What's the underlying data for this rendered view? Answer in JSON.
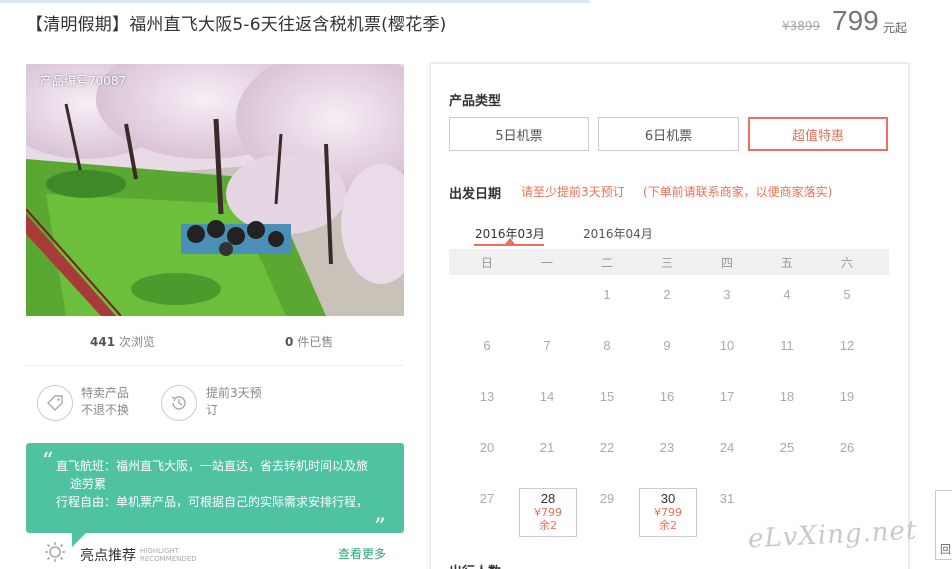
{
  "product": {
    "title": "【清明假期】福州直飞大阪5-6天往返含税机票(樱花季)",
    "original_price": "¥3899",
    "price": "799",
    "price_unit": "元起",
    "code": "产品编号70087"
  },
  "stats": {
    "views_count": "441",
    "views_label": "次浏览",
    "sold_count": "0",
    "sold_label": "件已售"
  },
  "features": [
    {
      "line1": "特卖产品",
      "line2": "不退不换",
      "icon": "tag-icon"
    },
    {
      "line1": "提前3天预",
      "line2": "订",
      "icon": "clock-icon"
    }
  ],
  "highlight": {
    "line1": "直飞航班：福州直飞大阪，一站直达，省去转机时间以及旅",
    "line2": "途劳累",
    "line3": "行程自由：单机票产品，可根据自己的实际需求安排行程，",
    "open_quote": "“",
    "close_quote": "„"
  },
  "recommend": {
    "title": "亮点推荐",
    "en_line1": "HIGHLIGHT",
    "en_line2": "RECOMMENDED",
    "more": "查看更多"
  },
  "panel": {
    "type_label": "产品类型",
    "types": [
      "5日机票",
      "6日机票",
      "超值特惠"
    ],
    "active_type": "超值特惠",
    "date_label": "出发日期",
    "notice1": "请至少提前3天预订",
    "notice2": "(下单前请联系商家，以便商家落实)",
    "months": [
      "2016年03月",
      "2016年04月"
    ],
    "active_month": "2016年03月",
    "weekdays": [
      "日",
      "一",
      "二",
      "三",
      "四",
      "五",
      "六"
    ],
    "weeks": [
      [
        "",
        "",
        "1",
        "2",
        "3",
        "4",
        "5"
      ],
      [
        "6",
        "7",
        "8",
        "9",
        "10",
        "11",
        "12"
      ],
      [
        "13",
        "14",
        "15",
        "16",
        "17",
        "18",
        "19"
      ],
      [
        "20",
        "21",
        "22",
        "23",
        "24",
        "25",
        "26"
      ],
      [
        "27",
        "28",
        "29",
        "30",
        "31",
        "",
        ""
      ]
    ],
    "available": [
      {
        "day": "28",
        "price": "¥799",
        "remain": "余2"
      },
      {
        "day": "30",
        "price": "¥799",
        "remain": "余2"
      }
    ],
    "next_label": "出行人数"
  },
  "watermark": "eLvXing.net",
  "side_tab": "回",
  "colors": {
    "accent": "#e9705a",
    "highlight_bg": "#4fc3a1",
    "link_green": "#2aa877"
  }
}
